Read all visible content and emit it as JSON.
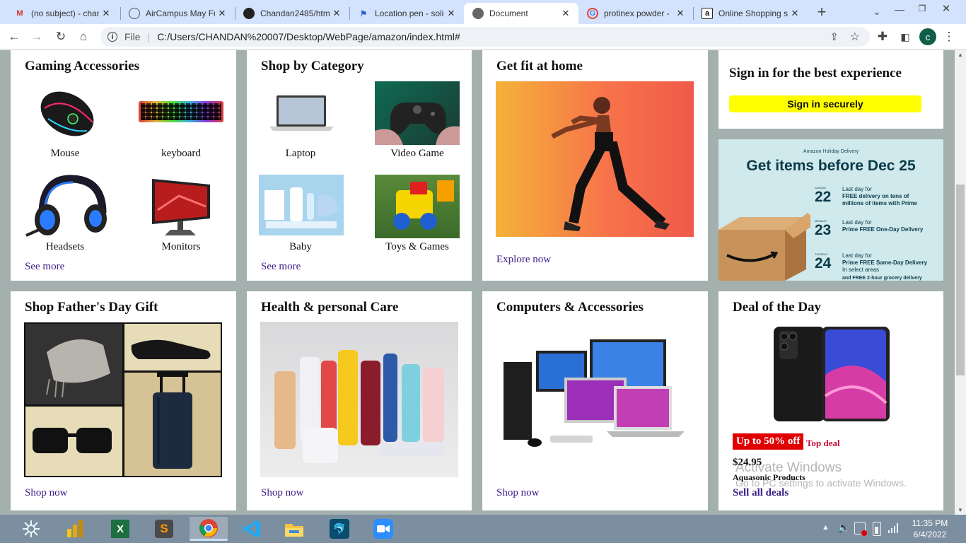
{
  "tabs": [
    {
      "title": "(no subject) - chan",
      "icon": "gmail-icon"
    },
    {
      "title": "AirCampus May Fu",
      "icon": "globe-icon"
    },
    {
      "title": "Chandan2485/htm",
      "icon": "github-icon"
    },
    {
      "title": "Location pen - soli",
      "icon": "flag-icon"
    },
    {
      "title": "Document",
      "icon": "globe-icon"
    },
    {
      "title": "protinex powder -",
      "icon": "google-icon"
    },
    {
      "title": "Online Shopping s",
      "icon": "amazon-icon"
    }
  ],
  "address": {
    "scheme": "File",
    "url": "C:/Users/CHANDAN%20007/Desktop/WebPage/amazon/index.html#"
  },
  "profile_initial": "c",
  "cards": {
    "gaming": {
      "title": "Gaming Accessories",
      "items": [
        "Mouse",
        "keyboard",
        "Headsets",
        "Monitors"
      ],
      "link": "See more"
    },
    "category": {
      "title": "Shop by Category",
      "items": [
        "Laptop",
        "Video Game",
        "Baby",
        "Toys & Games"
      ],
      "link": "See more"
    },
    "fit": {
      "title": "Get fit at home",
      "link": "Explore now"
    },
    "signin": {
      "title": "Sign in for the best experience",
      "button": "Sign in securely"
    },
    "holiday": {
      "eyebrow": "Amazon Holiday Delivery",
      "headline": "Get items before Dec 25",
      "rows": [
        {
          "day": "SUNDAY",
          "date": "22",
          "l1": "Last day for",
          "l2": "FREE delivery on tens of",
          "l3": "millions of items with Prime"
        },
        {
          "day": "MONDAY",
          "date": "23",
          "l1": "Last day for",
          "l2": "Prime FREE One-Day Delivery",
          "l3": ""
        },
        {
          "day": "TUESDAY",
          "date": "24",
          "l1": "Last day for",
          "l2": "Prime FREE Same-Day Delivery",
          "l3": "In select areas"
        }
      ],
      "footer": "and FREE 2-hour grocery delivery"
    },
    "father": {
      "title": "Shop Father's Day Gift",
      "link": "Shop now"
    },
    "health": {
      "title": "Health & personal Care",
      "link": "Shop now"
    },
    "computers": {
      "title": "Computers & Accessories",
      "link": "Shop now"
    },
    "deal": {
      "title": "Deal of the Day",
      "badge": "Up to 50% off",
      "tag": "Top deal",
      "price": "$24.95",
      "brand": "Aquasonic Products",
      "link": "Sell all deals"
    }
  },
  "watermark": {
    "line1": "Activate Windows",
    "line2": "Go to PC settings to activate Windows."
  },
  "clock": {
    "time": "11:35 PM",
    "date": "6/4/2022"
  },
  "colors": {
    "tabbar": "#d3e3fd",
    "page_bg": "#a3b0ae",
    "link": "#3b1d85",
    "signin_button": "#ffff00",
    "deal_badge": "#e00000"
  }
}
